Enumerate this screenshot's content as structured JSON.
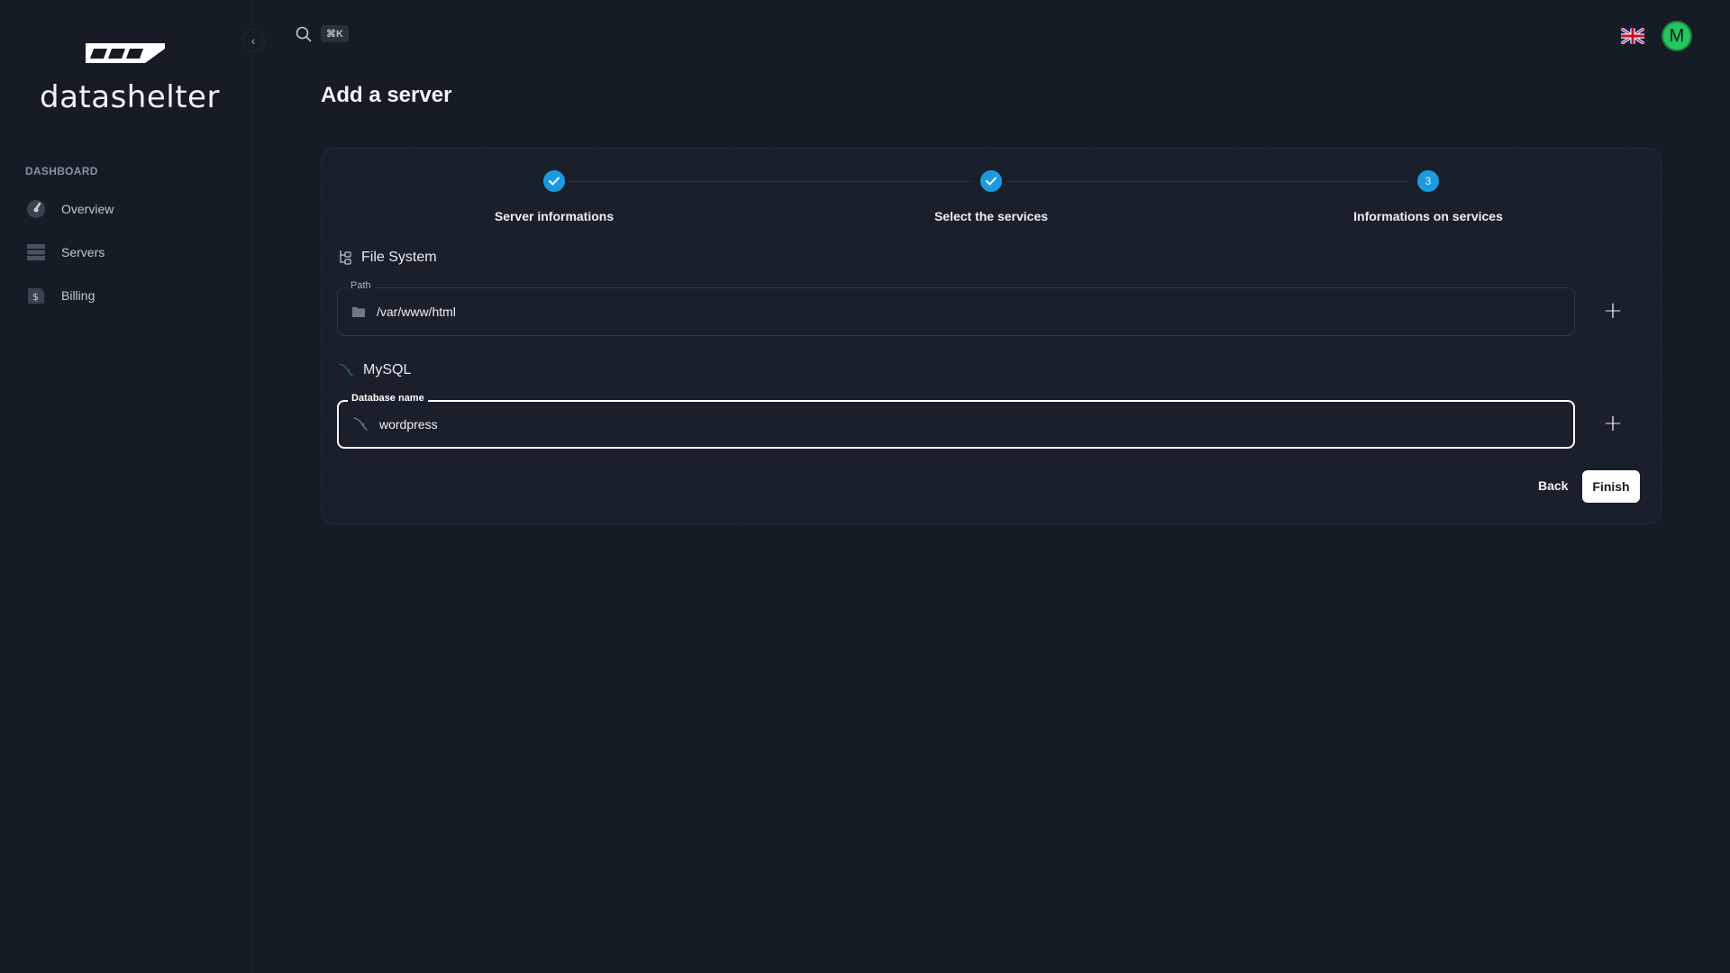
{
  "brand": {
    "name": "datashelter"
  },
  "sidebar": {
    "section": "DASHBOARD",
    "items": [
      {
        "label": "Overview",
        "icon": "gauge-icon"
      },
      {
        "label": "Servers",
        "icon": "server-icon"
      },
      {
        "label": "Billing",
        "icon": "billing-icon"
      }
    ]
  },
  "topbar": {
    "shortcut": "⌘K",
    "avatar_initial": "M",
    "avatar_color": "#22c55e"
  },
  "page": {
    "title": "Add a server"
  },
  "stepper": {
    "steps": [
      {
        "label": "Server informations",
        "state": "done"
      },
      {
        "label": "Select the services",
        "state": "done"
      },
      {
        "label": "Informations on services",
        "state": "current",
        "number": "3"
      }
    ]
  },
  "filesystem": {
    "title": "File System",
    "path_label": "Path",
    "path_value": "/var/www/html"
  },
  "mysql": {
    "title": "MySQL",
    "db_label": "Database name",
    "db_value": "wordpress"
  },
  "actions": {
    "back": "Back",
    "finish": "Finish"
  },
  "colors": {
    "accent": "#1a9be0",
    "background": "#161c25"
  }
}
